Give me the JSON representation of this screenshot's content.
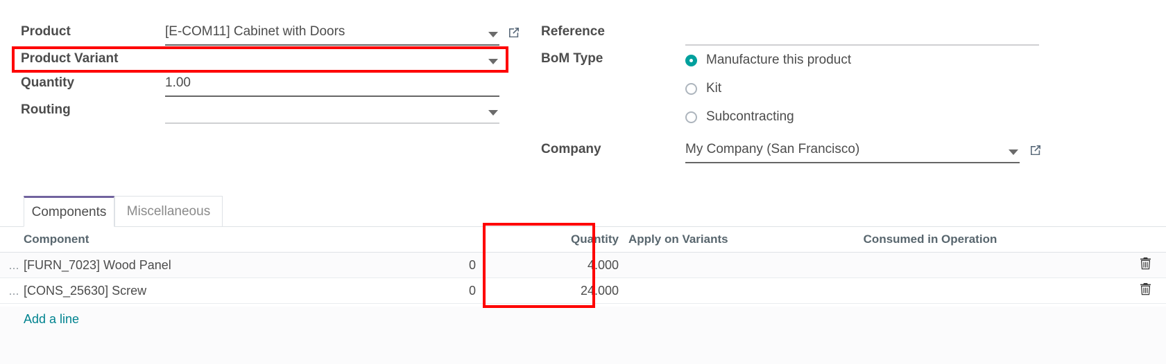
{
  "form": {
    "product": {
      "label": "Product",
      "value": "[E-COM11] Cabinet with Doors",
      "caret": "chevron-down-icon",
      "external": "external-link-icon"
    },
    "product_variant": {
      "label": "Product Variant",
      "value": "",
      "placeholder": "",
      "caret": "chevron-down-icon"
    },
    "quantity": {
      "label": "Quantity",
      "value": "1.00"
    },
    "routing": {
      "label": "Routing",
      "value": "",
      "caret": "chevron-down-icon"
    },
    "reference": {
      "label": "Reference",
      "value": ""
    },
    "bom_type": {
      "label": "BoM Type",
      "options": [
        {
          "label": "Manufacture this product",
          "selected": true
        },
        {
          "label": "Kit",
          "selected": false
        },
        {
          "label": "Subcontracting",
          "selected": false
        }
      ]
    },
    "company": {
      "label": "Company",
      "value": "My Company (San Francisco)",
      "caret": "chevron-down-icon",
      "external": "external-link-icon"
    }
  },
  "tabs": [
    {
      "label": "Components",
      "active": true
    },
    {
      "label": "Miscellaneous",
      "active": false
    }
  ],
  "table": {
    "headers": {
      "handle": "",
      "component": "Component",
      "blank_zero": "",
      "quantity": "Quantity",
      "apply_on_variants": "Apply on Variants",
      "consumed_in_operation": "Consumed in Operation",
      "trash": ""
    },
    "rows": [
      {
        "handle": "...",
        "component": "[FURN_7023] Wood Panel",
        "zero": "0",
        "quantity": "4.000",
        "apply_on_variants": "",
        "consumed_in_operation": "",
        "trash": "trash-icon"
      },
      {
        "handle": "...",
        "component": "[CONS_25630] Screw",
        "zero": "0",
        "quantity": "24.000",
        "apply_on_variants": "",
        "consumed_in_operation": "",
        "trash": "trash-icon"
      }
    ],
    "add_line": "Add a line"
  },
  "annotations": {
    "highlight_1": "product-variant-field",
    "highlight_2": "apply-on-variants-column"
  },
  "colors": {
    "accent_teal": "#00a09d",
    "tab_active": "#71639e",
    "link": "#00838f",
    "annotation_red": "#fe0000",
    "label_text": "#4c4c4c"
  }
}
